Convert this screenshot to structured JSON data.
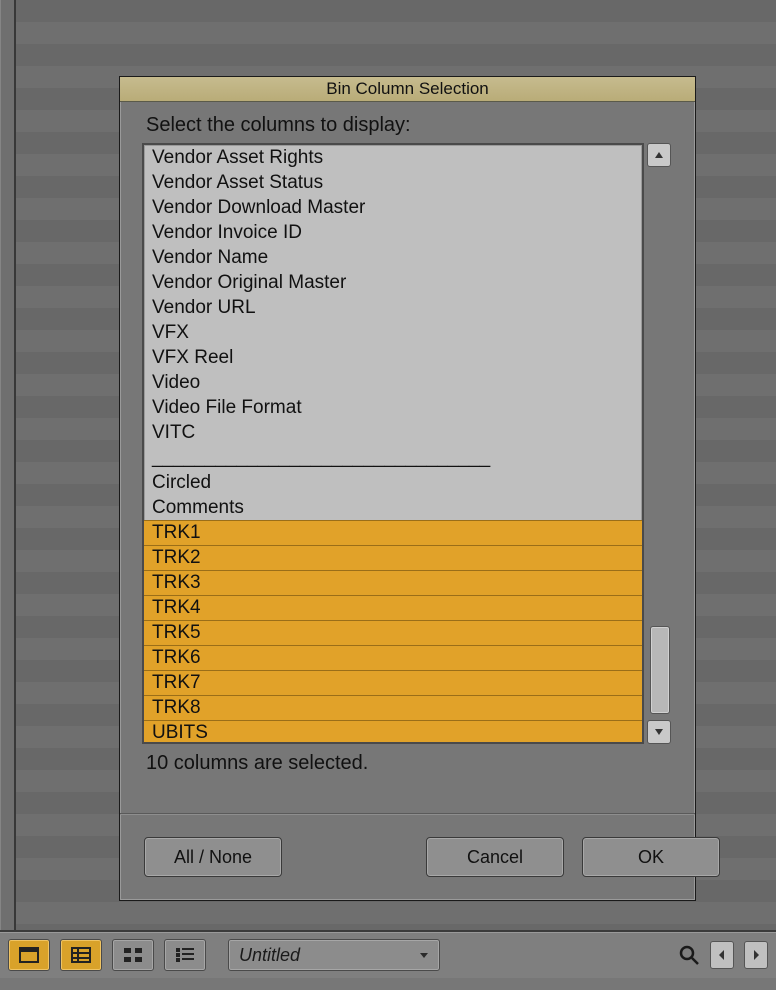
{
  "dialog": {
    "title": "Bin Column Selection",
    "prompt": "Select the columns to display:",
    "items": [
      {
        "label": "Vendor Asset Rights",
        "selected": false
      },
      {
        "label": "Vendor Asset Status",
        "selected": false
      },
      {
        "label": "Vendor Download Master",
        "selected": false
      },
      {
        "label": "Vendor Invoice ID",
        "selected": false
      },
      {
        "label": "Vendor Name",
        "selected": false
      },
      {
        "label": "Vendor Original Master",
        "selected": false
      },
      {
        "label": "Vendor URL",
        "selected": false
      },
      {
        "label": "VFX",
        "selected": false
      },
      {
        "label": "VFX Reel",
        "selected": false
      },
      {
        "label": "Video",
        "selected": false
      },
      {
        "label": "Video File Format",
        "selected": false
      },
      {
        "label": "VITC",
        "selected": false
      },
      {
        "label": "________________________________",
        "selected": false,
        "divider": true
      },
      {
        "label": "Circled",
        "selected": false
      },
      {
        "label": "Comments",
        "selected": false
      },
      {
        "label": "TRK1",
        "selected": true
      },
      {
        "label": "TRK2",
        "selected": true
      },
      {
        "label": "TRK3",
        "selected": true
      },
      {
        "label": "TRK4",
        "selected": true
      },
      {
        "label": "TRK5",
        "selected": true
      },
      {
        "label": "TRK6",
        "selected": true
      },
      {
        "label": "TRK7",
        "selected": true
      },
      {
        "label": "TRK8",
        "selected": true
      },
      {
        "label": "UBITS",
        "selected": true
      }
    ],
    "status": "10 columns are selected.",
    "buttons": {
      "all_none": "All / None",
      "cancel": "Cancel",
      "ok": "OK"
    }
  },
  "bottom_bar": {
    "view_modes": [
      "frame-view",
      "list-view",
      "grid-view",
      "story-view"
    ],
    "active_view": 1,
    "title_field": "Untitled"
  }
}
